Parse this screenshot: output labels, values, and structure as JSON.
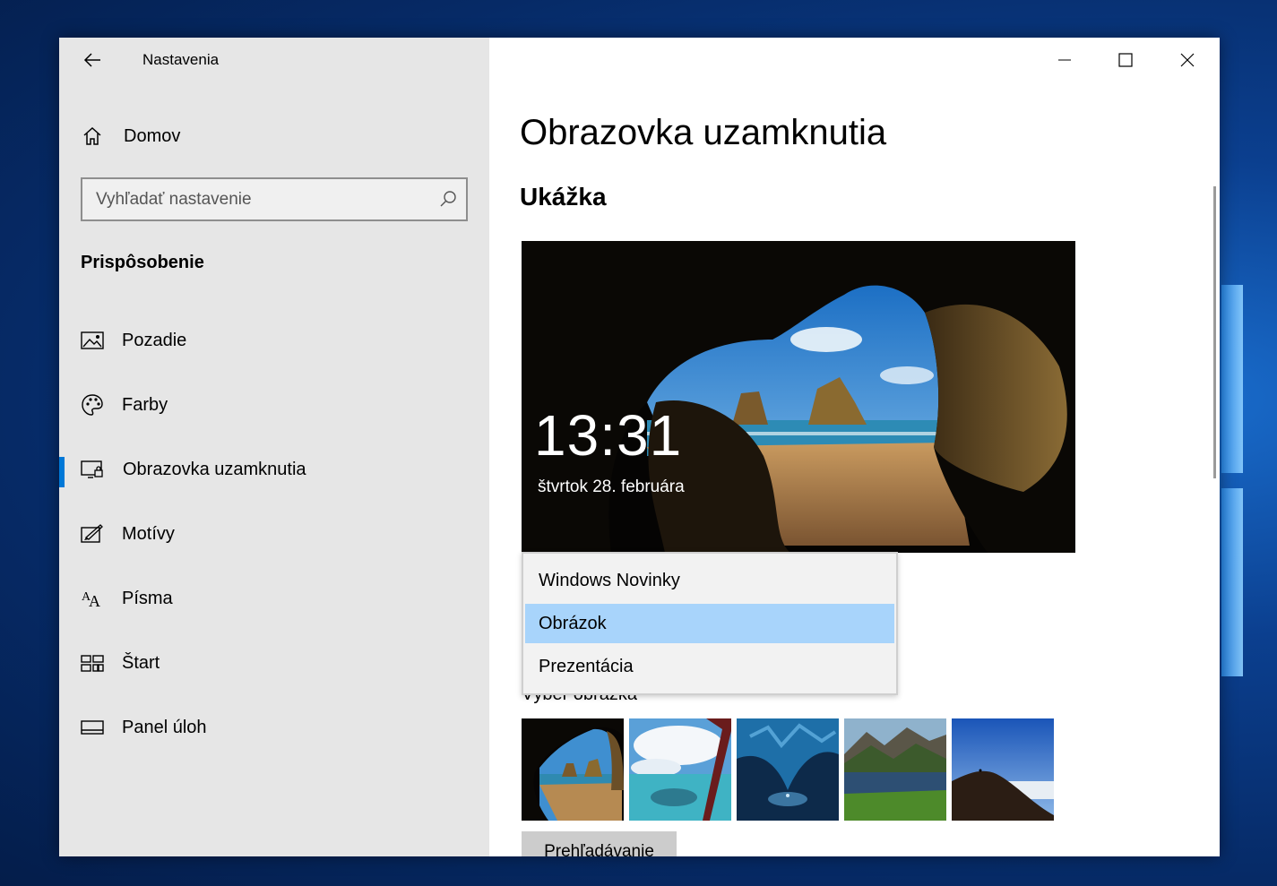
{
  "app": {
    "title": "Nastavenia"
  },
  "sidebar": {
    "home_label": "Domov",
    "search_placeholder": "Vyhľadať nastavenie",
    "section_title": "Prispôsobenie",
    "items": [
      {
        "label": "Pozadie",
        "icon": "picture-icon"
      },
      {
        "label": "Farby",
        "icon": "palette-icon"
      },
      {
        "label": "Obrazovka uzamknutia",
        "icon": "lock-screen-icon",
        "active": true
      },
      {
        "label": "Motívy",
        "icon": "theme-brush-icon"
      },
      {
        "label": "Písma",
        "icon": "fonts-icon"
      },
      {
        "label": "Štart",
        "icon": "start-tiles-icon"
      },
      {
        "label": "Panel úloh",
        "icon": "taskbar-icon"
      }
    ]
  },
  "main": {
    "page_title": "Obrazovka uzamknutia",
    "preview_title": "Ukážka",
    "preview": {
      "time": "13:31",
      "date": "štvrtok 28. februára"
    },
    "background_dropdown": {
      "options": [
        "Windows Novinky",
        "Obrázok",
        "Prezentácia"
      ],
      "selected": "Obrázok"
    },
    "choose_picture_label": "Výber obrázka",
    "browse_button": "Prehľadávanie"
  },
  "colors": {
    "accent": "#0078d7",
    "sidebar_bg": "#e6e6e6",
    "dropdown_selected": "#a8d4fb"
  }
}
